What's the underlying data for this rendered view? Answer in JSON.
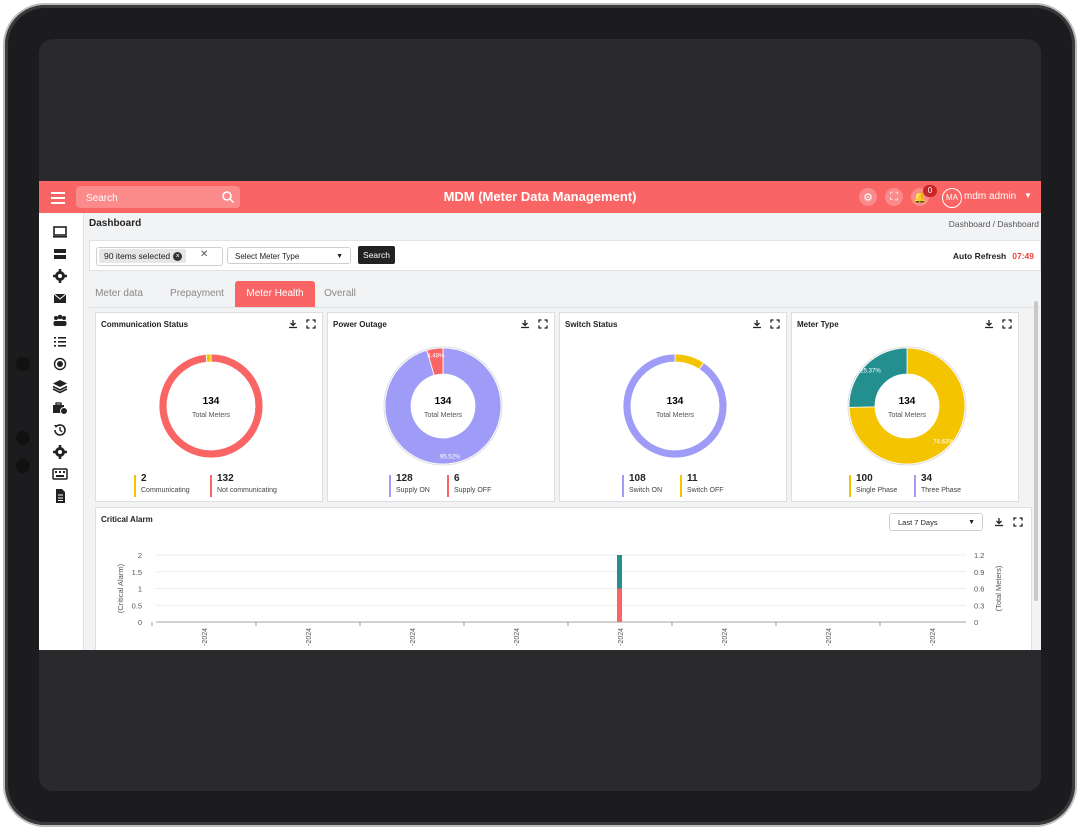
{
  "app": {
    "title": "MDM (Meter Data Management)",
    "search_placeholder": "Search",
    "notification_count": "0",
    "user_initials": "MA",
    "user_name": "mdm admin"
  },
  "page": {
    "title": "Dashboard",
    "breadcrumb": "Dashboard / Dashboard"
  },
  "filters": {
    "selected_chip": "90 items selected",
    "meter_type_placeholder": "Select Meter Type",
    "search_label": "Search",
    "auto_refresh_label": "Auto Refresh",
    "auto_refresh_time": "07:49"
  },
  "tabs": [
    {
      "label": "Meter data",
      "active": false
    },
    {
      "label": "Prepayment",
      "active": false
    },
    {
      "label": "Meter Health",
      "active": true
    },
    {
      "label": "Overall",
      "active": false
    }
  ],
  "cards": [
    {
      "title": "Communication Status",
      "total": "134",
      "total_label": "Total Meters",
      "slices": [
        {
          "name": "Communicating",
          "value": "2",
          "fraction": 0.015,
          "color": "#f5c400"
        },
        {
          "name": "Not communicating",
          "value": "132",
          "fraction": 0.985,
          "color": "#f96565"
        }
      ]
    },
    {
      "title": "Power Outage",
      "total": "134",
      "total_label": "Total Meters",
      "slices": [
        {
          "name": "Supply ON",
          "value": "128",
          "fraction": 0.9552,
          "color": "#9e9cf7",
          "pct_label": "95.52%"
        },
        {
          "name": "Supply OFF",
          "value": "6",
          "fraction": 0.0448,
          "color": "#f96565",
          "pct_label": "4.48%"
        }
      ]
    },
    {
      "title": "Switch Status",
      "total": "134",
      "total_label": "Total Meters",
      "slices": [
        {
          "name": "Switch ON",
          "value": "108",
          "fraction": 0.907,
          "color": "#9e9cf7"
        },
        {
          "name": "Switch OFF",
          "value": "11",
          "fraction": 0.093,
          "color": "#f5c400"
        }
      ]
    },
    {
      "title": "Meter Type",
      "total": "134",
      "total_label": "Total Meters",
      "slices": [
        {
          "name": "Single Phase",
          "value": "100",
          "fraction": 0.7463,
          "color": "#f5c400",
          "pct_label": "74.63%"
        },
        {
          "name": "Three Phase",
          "value": "34",
          "fraction": 0.2537,
          "color": "#23908f",
          "pct_label": "25.37%"
        }
      ]
    }
  ],
  "critical_alarm": {
    "title": "Critical Alarm",
    "period": "Last 7 Days",
    "chart_data": {
      "type": "bar",
      "ylabel": "(Critical Alarm)",
      "y2label": "(Total Meters)",
      "ylim": [
        0,
        2
      ],
      "y2lim": [
        0,
        1.2
      ],
      "y_ticks": [
        "2",
        "1.5",
        "1",
        "0.5",
        "0"
      ],
      "y2_ticks": [
        "1.2",
        "0.9",
        "0.6",
        "0.3",
        "0"
      ],
      "x_tick_labels": [
        "-2024",
        "-2024",
        "-2024",
        "-2024",
        "-2024",
        "-2024",
        "-2024",
        "-2024"
      ],
      "series": [
        {
          "color": "#f96565",
          "values": [
            0,
            0,
            0,
            0,
            1,
            0,
            0,
            0
          ]
        },
        {
          "color": "#23908f",
          "values": [
            0,
            0,
            0,
            0,
            1,
            0,
            0,
            0
          ]
        }
      ]
    }
  }
}
